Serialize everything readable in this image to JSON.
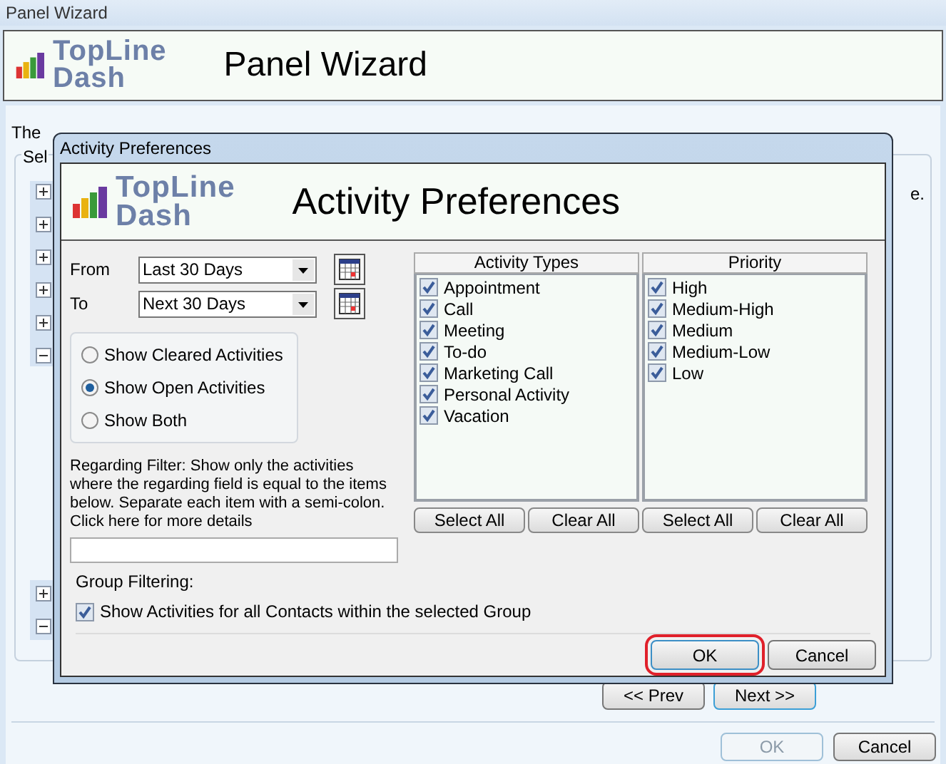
{
  "window": {
    "title": "Panel Wizard"
  },
  "header": {
    "logo": [
      "TopLine",
      "Dash"
    ],
    "title": "Panel Wizard"
  },
  "intro": "The",
  "group": {
    "label": "Sel",
    "fragment": "e.",
    "expanders": [
      {
        "expanded": false
      },
      {
        "expanded": false
      },
      {
        "expanded": false
      },
      {
        "expanded": false
      },
      {
        "expanded": false
      },
      {
        "expanded": true
      }
    ],
    "lower_expanders": [
      {
        "expanded": false
      },
      {
        "expanded": true
      }
    ]
  },
  "dialog": {
    "title": "Activity Preferences",
    "logo": [
      "TopLine",
      "Dash"
    ],
    "heading": "Activity Preferences",
    "date_range": [
      {
        "label": "From",
        "value": "Last 30 Days"
      },
      {
        "label": "To",
        "value": "Next 30 Days"
      }
    ],
    "show_options": [
      {
        "label": "Show Cleared Activities",
        "selected": false
      },
      {
        "label": "Show Open Activities",
        "selected": true
      },
      {
        "label": "Show Both",
        "selected": false
      }
    ],
    "regarding_filter": "Regarding Filter: Show only the activities where the regarding field is equal to the items below.  Separate each item with a semi-colon.  Click here for more details",
    "lists": [
      {
        "header": "Activity Types",
        "items": [
          {
            "label": "Appointment",
            "checked": true
          },
          {
            "label": "Call",
            "checked": true
          },
          {
            "label": "Meeting",
            "checked": true
          },
          {
            "label": "To-do",
            "checked": true
          },
          {
            "label": "Marketing Call",
            "checked": true
          },
          {
            "label": "Personal Activity",
            "checked": true
          },
          {
            "label": "Vacation",
            "checked": true
          }
        ],
        "buttons": [
          "Select All",
          "Clear All"
        ]
      },
      {
        "header": "Priority",
        "items": [
          {
            "label": "High",
            "checked": true
          },
          {
            "label": "Medium-High",
            "checked": true
          },
          {
            "label": "Medium",
            "checked": true
          },
          {
            "label": "Medium-Low",
            "checked": true
          },
          {
            "label": "Low",
            "checked": true
          }
        ],
        "buttons": [
          "Select All",
          "Clear All"
        ]
      }
    ],
    "group_filtering": {
      "label": "Group Filtering:",
      "option": {
        "label": "Show Activities for all Contacts within the selected Group",
        "checked": true
      }
    },
    "buttons": [
      {
        "label": "OK",
        "highlighted": true
      },
      {
        "label": "Cancel",
        "highlighted": false
      }
    ]
  },
  "nav_buttons": [
    {
      "label": "<< Prev",
      "default": false
    },
    {
      "label": "Next >>",
      "default": true
    }
  ],
  "footer_buttons": [
    {
      "label": "OK",
      "disabled": true
    },
    {
      "label": "Cancel",
      "disabled": false
    }
  ]
}
